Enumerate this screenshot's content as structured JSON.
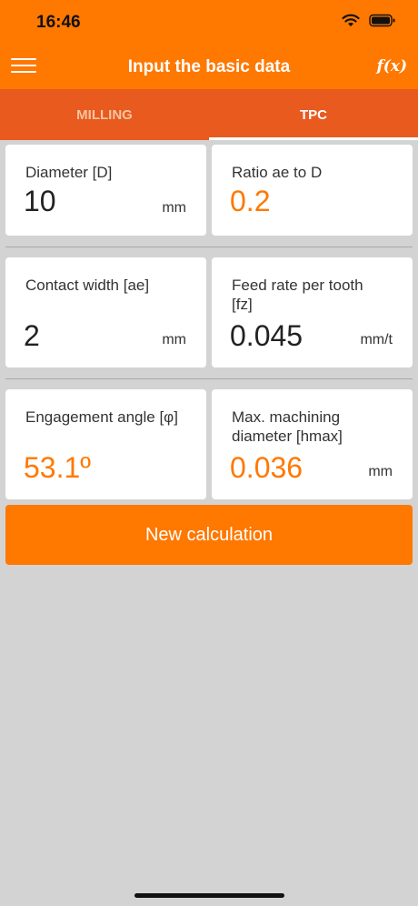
{
  "status": {
    "time": "16:46"
  },
  "header": {
    "title": "Input the basic data",
    "fx_label": "f(x)"
  },
  "tabs": [
    {
      "label": "MILLING",
      "active": false
    },
    {
      "label": "TPC",
      "active": true
    }
  ],
  "fields": {
    "diameter": {
      "label": "Diameter [D]",
      "value": "10",
      "unit": "mm"
    },
    "ratio": {
      "label": "Ratio ae to D",
      "value": "0.2",
      "unit": ""
    },
    "contact_width": {
      "label": "Contact width [ae]",
      "value": "2",
      "unit": "mm"
    },
    "feed_rate": {
      "label": "Feed rate per tooth [fz]",
      "value": "0.045",
      "unit": "mm/t"
    },
    "engagement_angle": {
      "label": "Engagement angle [φ]",
      "value": "53.1º",
      "unit": ""
    },
    "max_diameter": {
      "label": "Max. machining diameter [hmax]",
      "value": "0.036",
      "unit": "mm"
    }
  },
  "actions": {
    "new_calculation": "New calculation"
  },
  "colors": {
    "accent": "#ff7800",
    "tab_bar": "#e85a1e",
    "background": "#d3d3d3"
  }
}
